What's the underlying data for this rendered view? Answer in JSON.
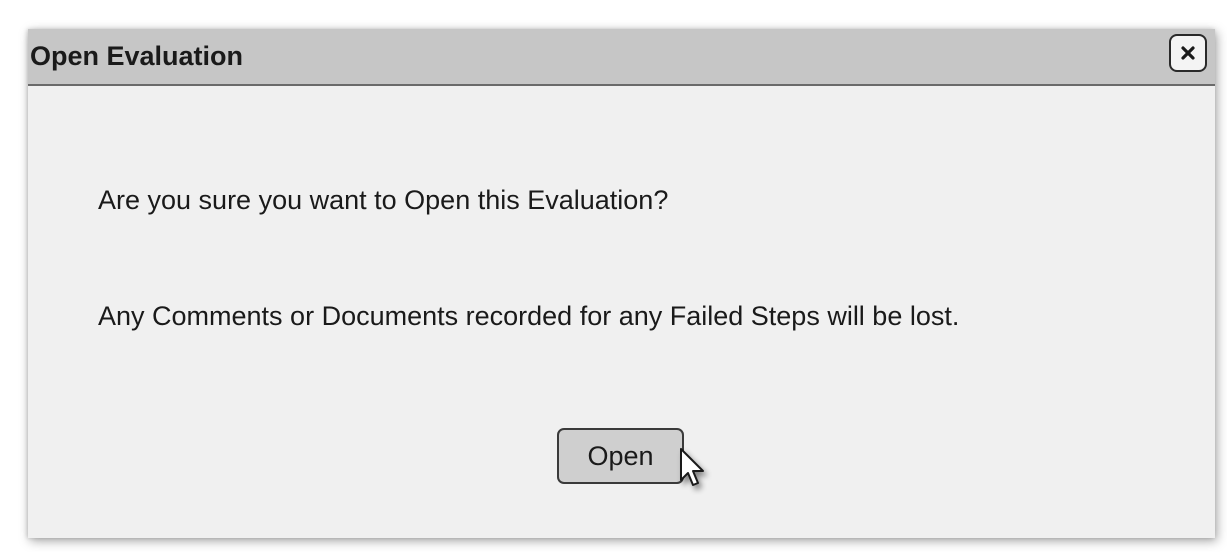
{
  "dialog": {
    "title": "Open Evaluation",
    "close_icon": "close-icon",
    "message_line1": "Are you sure you want to Open this Evaluation?",
    "message_line2": "Any Comments or Documents recorded for any Failed Steps will be lost.",
    "open_button_label": "Open"
  },
  "cursor_icon": "pointer-cursor-icon",
  "colors": {
    "titlebar": "#c6c6c6",
    "body": "#f0f0f0",
    "button": "#cfcfcf",
    "text": "#1a1a1a"
  }
}
